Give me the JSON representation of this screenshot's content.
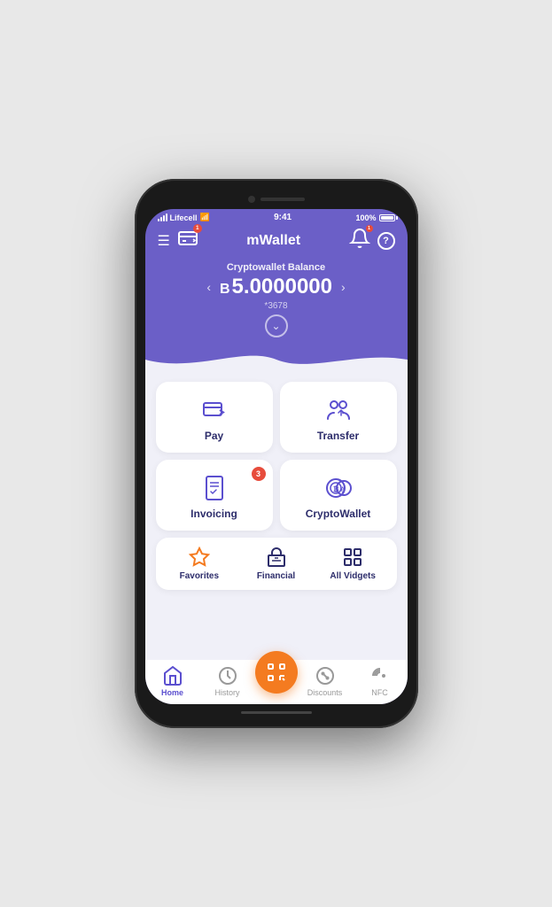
{
  "status_bar": {
    "carrier": "Lifecell",
    "time": "9:41",
    "battery": "100%"
  },
  "header": {
    "title": "mWallet",
    "notification_badge": "1",
    "card_badge": "1"
  },
  "balance": {
    "label": "Cryptowallet Balance",
    "symbol": "B",
    "amount": "5.0000000",
    "account": "*3678"
  },
  "services": [
    {
      "id": "pay",
      "label": "Pay",
      "badge": null
    },
    {
      "id": "transfer",
      "label": "Transfer",
      "badge": null
    },
    {
      "id": "invoicing",
      "label": "Invoicing",
      "badge": "3"
    },
    {
      "id": "cryptowallet",
      "label": "CryptoWallet",
      "badge": null
    }
  ],
  "tools": [
    {
      "id": "favorites",
      "label": "Favorites",
      "color": "orange"
    },
    {
      "id": "financial",
      "label": "Financial",
      "color": "blue"
    },
    {
      "id": "all-vidgets",
      "label": "All Vidgets",
      "color": "blue"
    }
  ],
  "nav": [
    {
      "id": "home",
      "label": "Home",
      "active": true
    },
    {
      "id": "history",
      "label": "History",
      "active": false
    },
    {
      "id": "scan",
      "label": "",
      "scan": true
    },
    {
      "id": "discounts",
      "label": "Discounts",
      "active": false
    },
    {
      "id": "nfc",
      "label": "NFC",
      "active": false
    }
  ]
}
